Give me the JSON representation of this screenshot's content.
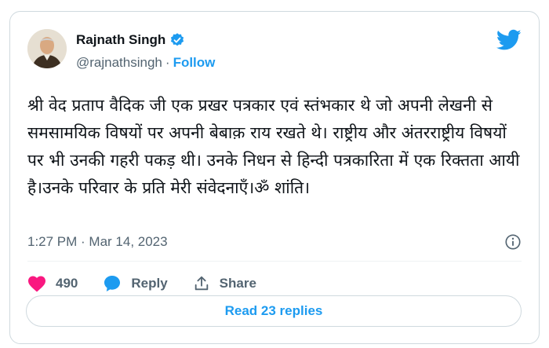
{
  "author": {
    "name": "Rajnath Singh",
    "handle": "@rajnathsingh",
    "separator": "·",
    "follow_label": "Follow"
  },
  "tweet": {
    "text": "श्री वेद प्रताप वैदिक जी एक प्रखर पत्रकार एवं स्तंभकार थे जो अपनी लेखनी से समसामयिक विषयों पर अपनी बेबाक़ राय रखते थे। राष्ट्रीय और अंतरराष्ट्रीय विषयों पर भी उनकी गहरी पकड़ थी। उनके निधन से हिन्दी पत्रकारिता में एक रिक्तता आयी है।उनके परिवार के प्रति मेरी संवेदनाएँ।ॐ शांति।",
    "timestamp": "1:27 PM · Mar 14, 2023"
  },
  "actions": {
    "like_count": "490",
    "reply_label": "Reply",
    "share_label": "Share"
  },
  "read_replies_label": "Read 23 replies",
  "colors": {
    "accent": "#1d9bf0",
    "like": "#f91880",
    "muted": "#536471"
  },
  "icons": [
    "verified-badge-icon",
    "twitter-bird-icon",
    "info-icon",
    "heart-icon",
    "reply-bubble-icon",
    "share-icon"
  ]
}
